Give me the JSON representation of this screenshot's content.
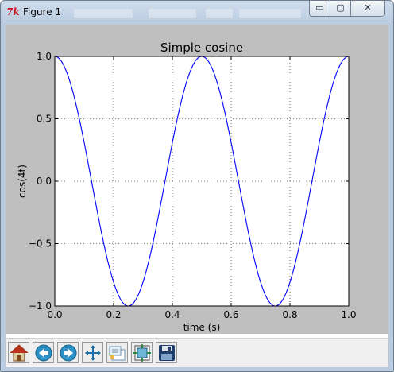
{
  "window": {
    "title": "Figure 1",
    "buttons": {
      "minimize": "▭",
      "maximize": "▢",
      "close": "✕"
    }
  },
  "chart_data": {
    "type": "line",
    "title": "Simple cosine",
    "xlabel": "time (s)",
    "ylabel": "cos(4t)",
    "xlim": [
      0.0,
      1.0
    ],
    "ylim": [
      -1.0,
      1.0
    ],
    "xticks": [
      "0.0",
      "0.2",
      "0.4",
      "0.6",
      "0.8",
      "1.0"
    ],
    "yticks": [
      "1.0",
      "0.5",
      "0.0",
      "−0.5",
      "−1.0"
    ],
    "grid": true,
    "series": [
      {
        "color": "#0000ff",
        "function": "cos(4*pi*t)",
        "x": [
          0.0,
          0.05,
          0.1,
          0.15,
          0.2,
          0.25,
          0.3,
          0.35,
          0.4,
          0.45,
          0.5,
          0.55,
          0.6,
          0.65,
          0.7,
          0.75,
          0.8,
          0.85,
          0.9,
          0.95,
          1.0
        ],
        "y": [
          1.0,
          0.809,
          0.309,
          -0.309,
          -0.809,
          -1.0,
          -0.809,
          -0.309,
          0.309,
          0.809,
          1.0,
          0.809,
          0.309,
          -0.309,
          -0.809,
          -1.0,
          -0.809,
          -0.309,
          0.309,
          0.809,
          1.0
        ]
      }
    ]
  },
  "toolbar": {
    "buttons": [
      {
        "name": "home-button",
        "icon": "home-icon"
      },
      {
        "name": "back-button",
        "icon": "back-arrow-icon"
      },
      {
        "name": "forward-button",
        "icon": "forward-arrow-icon"
      },
      {
        "name": "pan-button",
        "icon": "pan-move-icon"
      },
      {
        "name": "zoom-button",
        "icon": "zoom-rect-icon"
      },
      {
        "name": "subplots-button",
        "icon": "subplots-config-icon"
      },
      {
        "name": "save-button",
        "icon": "floppy-save-icon"
      }
    ]
  }
}
